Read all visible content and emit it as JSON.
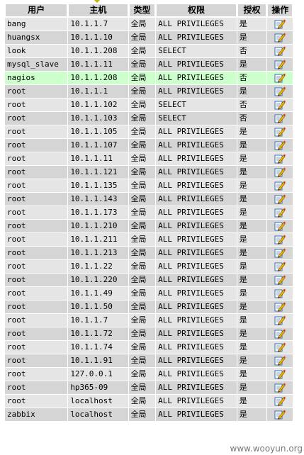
{
  "columns": {
    "user": "用户",
    "host": "主机",
    "type": "类型",
    "privileges": "权限",
    "grant": "授权",
    "action": "操作"
  },
  "rows": [
    {
      "user": "bang",
      "host": "10.1.1.7",
      "type": "全局",
      "privileges": "ALL PRIVILEGES",
      "grant": "是"
    },
    {
      "user": "huangsx",
      "host": "10.1.1.10",
      "type": "全局",
      "privileges": "ALL PRIVILEGES",
      "grant": "是"
    },
    {
      "user": "look",
      "host": "10.1.1.208",
      "type": "全局",
      "privileges": "SELECT",
      "grant": "否"
    },
    {
      "user": "mysql_slave",
      "host": "10.1.1.11",
      "type": "全局",
      "privileges": "ALL PRIVILEGES",
      "grant": "是"
    },
    {
      "user": "nagios",
      "host": "10.1.1.208",
      "type": "全局",
      "privileges": "ALL PRIVILEGES",
      "grant": "否",
      "highlighted": true
    },
    {
      "user": "root",
      "host": "10.1.1.1",
      "type": "全局",
      "privileges": "ALL PRIVILEGES",
      "grant": "是"
    },
    {
      "user": "root",
      "host": "10.1.1.102",
      "type": "全局",
      "privileges": "SELECT",
      "grant": "否"
    },
    {
      "user": "root",
      "host": "10.1.1.103",
      "type": "全局",
      "privileges": "SELECT",
      "grant": "否"
    },
    {
      "user": "root",
      "host": "10.1.1.105",
      "type": "全局",
      "privileges": "ALL PRIVILEGES",
      "grant": "是"
    },
    {
      "user": "root",
      "host": "10.1.1.107",
      "type": "全局",
      "privileges": "ALL PRIVILEGES",
      "grant": "是"
    },
    {
      "user": "root",
      "host": "10.1.1.11",
      "type": "全局",
      "privileges": "ALL PRIVILEGES",
      "grant": "是"
    },
    {
      "user": "root",
      "host": "10.1.1.121",
      "type": "全局",
      "privileges": "ALL PRIVILEGES",
      "grant": "是"
    },
    {
      "user": "root",
      "host": "10.1.1.135",
      "type": "全局",
      "privileges": "ALL PRIVILEGES",
      "grant": "是"
    },
    {
      "user": "root",
      "host": "10.1.1.143",
      "type": "全局",
      "privileges": "ALL PRIVILEGES",
      "grant": "是"
    },
    {
      "user": "root",
      "host": "10.1.1.173",
      "type": "全局",
      "privileges": "ALL PRIVILEGES",
      "grant": "是"
    },
    {
      "user": "root",
      "host": "10.1.1.210",
      "type": "全局",
      "privileges": "ALL PRIVILEGES",
      "grant": "是"
    },
    {
      "user": "root",
      "host": "10.1.1.211",
      "type": "全局",
      "privileges": "ALL PRIVILEGES",
      "grant": "是"
    },
    {
      "user": "root",
      "host": "10.1.1.213",
      "type": "全局",
      "privileges": "ALL PRIVILEGES",
      "grant": "是"
    },
    {
      "user": "root",
      "host": "10.1.1.22",
      "type": "全局",
      "privileges": "ALL PRIVILEGES",
      "grant": "是"
    },
    {
      "user": "root",
      "host": "10.1.1.220",
      "type": "全局",
      "privileges": "ALL PRIVILEGES",
      "grant": "是"
    },
    {
      "user": "root",
      "host": "10.1.1.49",
      "type": "全局",
      "privileges": "ALL PRIVILEGES",
      "grant": "是"
    },
    {
      "user": "root",
      "host": "10.1.1.50",
      "type": "全局",
      "privileges": "ALL PRIVILEGES",
      "grant": "是"
    },
    {
      "user": "root",
      "host": "10.1.1.7",
      "type": "全局",
      "privileges": "ALL PRIVILEGES",
      "grant": "是"
    },
    {
      "user": "root",
      "host": "10.1.1.72",
      "type": "全局",
      "privileges": "ALL PRIVILEGES",
      "grant": "是"
    },
    {
      "user": "root",
      "host": "10.1.1.74",
      "type": "全局",
      "privileges": "ALL PRIVILEGES",
      "grant": "是"
    },
    {
      "user": "root",
      "host": "10.1.1.91",
      "type": "全局",
      "privileges": "ALL PRIVILEGES",
      "grant": "是"
    },
    {
      "user": "root",
      "host": "127.0.0.1",
      "type": "全局",
      "privileges": "ALL PRIVILEGES",
      "grant": "是"
    },
    {
      "user": "root",
      "host": "hp365-09",
      "type": "全局",
      "privileges": "ALL PRIVILEGES",
      "grant": "是"
    },
    {
      "user": "root",
      "host": "localhost",
      "type": "全局",
      "privileges": "ALL PRIVILEGES",
      "grant": "是"
    },
    {
      "user": "zabbix",
      "host": "localhost",
      "type": "全局",
      "privileges": "ALL PRIVILEGES",
      "grant": "是"
    }
  ],
  "row_action_icon": "edit-privileges-icon",
  "colors": {
    "header_bg": "#d5d5d5",
    "row_odd_bg": "#e5e5e5",
    "row_even_bg": "#d5d5d5",
    "row_highlight_bg": "#ccffcc"
  },
  "watermark": "www.wooyun.org"
}
